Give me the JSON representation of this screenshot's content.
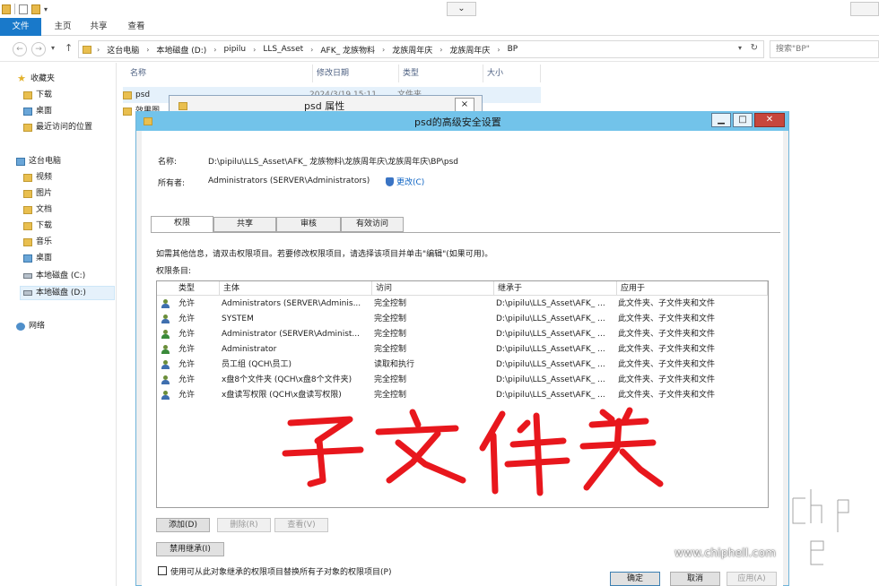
{
  "ribbon": {
    "tabs": [
      "文件",
      "主页",
      "共享",
      "查看"
    ]
  },
  "address": {
    "crumbs": [
      "这台电脑",
      "本地磁盘 (D:)",
      "pipilu",
      "LLS_Asset",
      "AFK_ 龙族物料",
      "龙族周年庆",
      "龙族周年庆",
      "BP"
    ],
    "search_placeholder": "搜索\"BP\""
  },
  "navpane": {
    "favorites": "收藏夹",
    "fav_items": [
      "下载",
      "桌面",
      "最近访问的位置"
    ],
    "this_pc": "这台电脑",
    "pc_items": [
      "视频",
      "图片",
      "文档",
      "下载",
      "音乐",
      "桌面"
    ],
    "drive_c": "本地磁盘 (C:)",
    "drive_d": "本地磁盘 (D:)",
    "network": "网络"
  },
  "filelist": {
    "headers": [
      "名称",
      "修改日期",
      "类型",
      "大小"
    ],
    "rows": [
      {
        "name": "psd",
        "date": "2024/3/19 15:11",
        "type": "文件夹"
      },
      {
        "name": "效果图"
      }
    ]
  },
  "props_dialog": {
    "title": "psd 属性",
    "close": "×"
  },
  "adv_dialog": {
    "title": "psd的高级安全设置",
    "name_label": "名称:",
    "name_value": "D:\\pipilu\\LLS_Asset\\AFK_ 龙族物料\\龙族周年庆\\龙族周年庆\\BP\\psd",
    "owner_label": "所有者:",
    "owner_value": "Administrators (SERVER\\Administrators)",
    "change_link": "更改(C)",
    "tabs": [
      "权限",
      "共享",
      "审核",
      "有效访问"
    ],
    "info_text": "如需其他信息，请双击权限项目。若要修改权限项目，请选择该项目并单击\"编辑\"(如果可用)。",
    "entries_label": "权限条目:",
    "columns": [
      "类型",
      "主体",
      "访问",
      "继承于",
      "应用于"
    ],
    "rows": [
      {
        "type": "允许",
        "principal": "Administrators (SERVER\\Adminis...",
        "access": "完全控制",
        "inherited": "D:\\pipilu\\LLS_Asset\\AFK_ ...",
        "applies": "此文件夹、子文件夹和文件"
      },
      {
        "type": "允许",
        "principal": "SYSTEM",
        "access": "完全控制",
        "inherited": "D:\\pipilu\\LLS_Asset\\AFK_ ...",
        "applies": "此文件夹、子文件夹和文件"
      },
      {
        "type": "允许",
        "principal": "Administrator (SERVER\\Administ...",
        "access": "完全控制",
        "inherited": "D:\\pipilu\\LLS_Asset\\AFK_ ...",
        "applies": "此文件夹、子文件夹和文件"
      },
      {
        "type": "允许",
        "principal": "Administrator",
        "access": "完全控制",
        "inherited": "D:\\pipilu\\LLS_Asset\\AFK_ ...",
        "applies": "此文件夹、子文件夹和文件"
      },
      {
        "type": "允许",
        "principal": "员工组 (QCH\\员工)",
        "access": "读取和执行",
        "inherited": "D:\\pipilu\\LLS_Asset\\AFK_ ...",
        "applies": "此文件夹、子文件夹和文件"
      },
      {
        "type": "允许",
        "principal": "x盘8个文件夹 (QCH\\x盘8个文件夹)",
        "access": "完全控制",
        "inherited": "D:\\pipilu\\LLS_Asset\\AFK_ ...",
        "applies": "此文件夹、子文件夹和文件"
      },
      {
        "type": "允许",
        "principal": "x盘读写权限 (QCH\\x盘读写权限)",
        "access": "完全控制",
        "inherited": "D:\\pipilu\\LLS_Asset\\AFK_ ...",
        "applies": "此文件夹、子文件夹和文件"
      }
    ],
    "btn_add": "添加(D)",
    "btn_remove": "删除(R)",
    "btn_view": "查看(V)",
    "btn_disable_inherit": "禁用继承(I)",
    "replace_checkbox": "使用可从此对象继承的权限项目替换所有子对象的权限项目(P)",
    "btn_ok": "确定",
    "btn_cancel": "取消",
    "btn_apply": "应用(A)"
  },
  "annotation": {
    "handwritten": "子文件夹"
  },
  "watermark": {
    "url": "www.chiphell.com",
    "logo": "chip hell"
  },
  "colors": {
    "accent": "#1979ca",
    "dialog_title": "#72c3ea",
    "close": "#c7463c",
    "ink": "#e8171d"
  }
}
